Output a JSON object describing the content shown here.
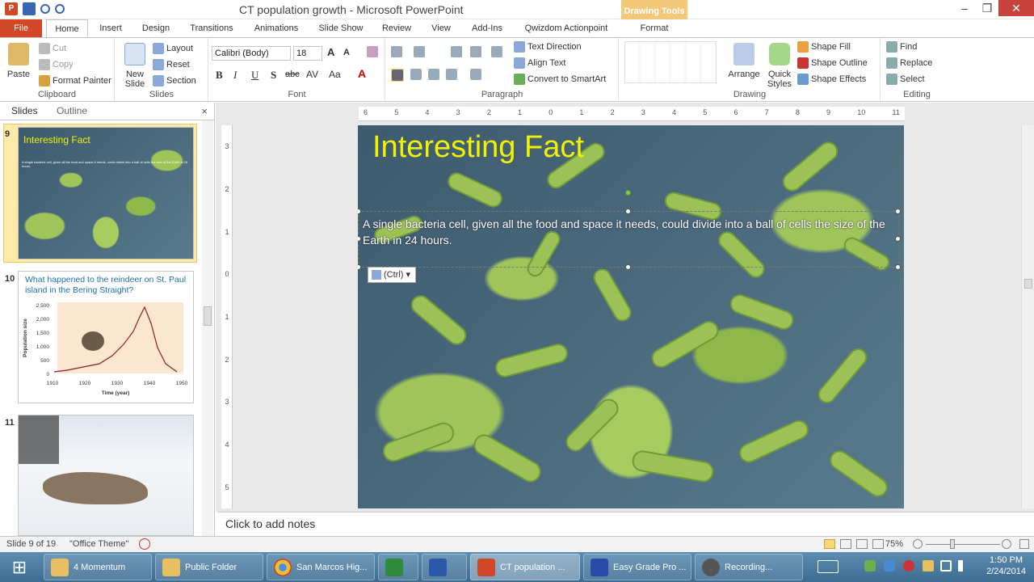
{
  "titlebar": {
    "title": "CT population growth - Microsoft PowerPoint",
    "contextual": "Drawing Tools",
    "minimize": "–",
    "maximize": "❐",
    "close": "✕"
  },
  "tabs": [
    "File",
    "Home",
    "Insert",
    "Design",
    "Transitions",
    "Animations",
    "Slide Show",
    "Review",
    "View",
    "Add-Ins",
    "Qwizdom Actionpoint",
    "Format"
  ],
  "ribbon": {
    "clipboard": {
      "paste": "Paste",
      "cut": "Cut",
      "copy": "Copy",
      "format_painter": "Format Painter",
      "label": "Clipboard"
    },
    "slides": {
      "new_slide": "New Slide",
      "layout": "Layout",
      "reset": "Reset",
      "section": "Section",
      "label": "Slides"
    },
    "font": {
      "family": "Calibri (Body)",
      "size": "18",
      "label": "Font",
      "bold": "B",
      "italic": "I",
      "underline": "U",
      "shadow": "S",
      "strike": "abc"
    },
    "paragraph": {
      "text_direction": "Text Direction",
      "align_text": "Align Text",
      "smartart": "Convert to SmartArt",
      "label": "Paragraph"
    },
    "drawing": {
      "arrange": "Arrange",
      "quick_styles": "Quick Styles",
      "shape_fill": "Shape Fill",
      "shape_outline": "Shape Outline",
      "shape_effects": "Shape Effects",
      "label": "Drawing"
    },
    "editing": {
      "find": "Find",
      "replace": "Replace",
      "select": "Select",
      "label": "Editing"
    }
  },
  "left_panel": {
    "tabs": [
      "Slides",
      "Outline"
    ],
    "close": "×",
    "thumbs": [
      {
        "num": "9",
        "title": "Interesting Fact",
        "body": "A single bacteria cell, given all the food and space it needs, could divide into a ball of cells the size of the Earth in 24 hours."
      },
      {
        "num": "10",
        "title": "What happened to the reindeer on St. Paul island in the Bering Straight?",
        "ylabel": "Population size",
        "xlabel": "Time (year)",
        "yticks": [
          "2,500",
          "2,000",
          "1,500",
          "1,000",
          "500",
          "0"
        ],
        "xticks": [
          "1910",
          "1920",
          "1930",
          "1940",
          "1950"
        ]
      },
      {
        "num": "11"
      }
    ]
  },
  "slide": {
    "title": "Interesting Fact",
    "body": "A single bacteria cell, given all the food and space it needs, could divide into a ball of cells the size of the Earth in 24 hours.",
    "paste_tag": "(Ctrl)"
  },
  "ruler": {
    "h": [
      "6",
      "5",
      "4",
      "3",
      "2",
      "1",
      "0",
      "1",
      "2",
      "3",
      "4",
      "5",
      "6",
      "7",
      "8",
      "9",
      "10",
      "11"
    ],
    "v": [
      "3",
      "2",
      "1",
      "0",
      "1",
      "2",
      "3",
      "4",
      "5"
    ]
  },
  "notes": {
    "placeholder": "Click to add notes"
  },
  "status": {
    "slide": "Slide 9 of 19",
    "theme": "\"Office Theme\"",
    "zoom": "75%"
  },
  "taskbar": {
    "items": [
      "4 Momentum",
      "Public Folder",
      "San Marcos Hig...",
      "",
      "",
      "CT population ...",
      "Easy Grade Pro ...",
      "Recording..."
    ],
    "time": "1:50 PM",
    "date": "2/24/2014"
  }
}
